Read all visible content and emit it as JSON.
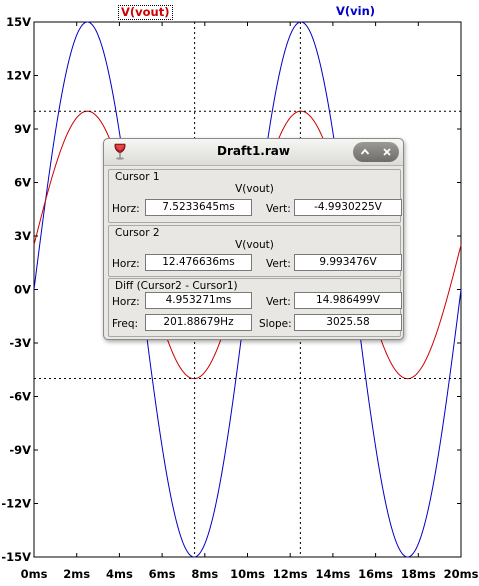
{
  "window": {
    "title": "Draft1.raw",
    "icon": "wine-icon",
    "buttons": [
      "maximize-button",
      "close-button"
    ]
  },
  "traces": {
    "vout": {
      "label": "V(vout)",
      "color": "#d00000"
    },
    "vin": {
      "label": "V(vin)",
      "color": "#0000c8"
    }
  },
  "cursor1": {
    "group_label": "Cursor 1",
    "trace": "V(vout)",
    "horz_label": "Horz:",
    "horz": "7.5233645ms",
    "vert_label": "Vert:",
    "vert": "-4.9930225V"
  },
  "cursor2": {
    "group_label": "Cursor 2",
    "trace": "V(vout)",
    "horz_label": "Horz:",
    "horz": "12.476636ms",
    "vert_label": "Vert:",
    "vert": "9.993476V"
  },
  "diff": {
    "group_label": "Diff (Cursor2 - Cursor1)",
    "horz_label": "Horz:",
    "horz": "4.953271ms",
    "vert_label": "Vert:",
    "vert": "14.986499V",
    "freq_label": "Freq:",
    "freq": "201.88679Hz",
    "slope_label": "Slope:",
    "slope": "3025.58"
  },
  "chart_data": {
    "type": "line",
    "x_unit": "ms",
    "xlim": [
      0,
      20
    ],
    "ylim": [
      -15,
      15
    ],
    "x_ticks": [
      "0ms",
      "2ms",
      "4ms",
      "6ms",
      "8ms",
      "10ms",
      "12ms",
      "14ms",
      "16ms",
      "18ms",
      "20ms"
    ],
    "y_ticks": [
      "15V",
      "12V",
      "9V",
      "6V",
      "3V",
      "0V",
      "-3V",
      "-6V",
      "-9V",
      "-12V",
      "-15V"
    ],
    "grid": false,
    "series": [
      {
        "name": "V(vin)",
        "color": "#0000c8",
        "amplitude": 15,
        "offset": 0,
        "frequency_hz": 100
      },
      {
        "name": "V(vout)",
        "color": "#d00000",
        "amplitude": 7.5,
        "offset": 2.5,
        "frequency_hz": 100
      }
    ],
    "cursors": [
      {
        "name": "Cursor 1",
        "x": 7.5233645,
        "y": -4.9930225
      },
      {
        "name": "Cursor 2",
        "x": 12.476636,
        "y": 9.993476
      }
    ]
  }
}
